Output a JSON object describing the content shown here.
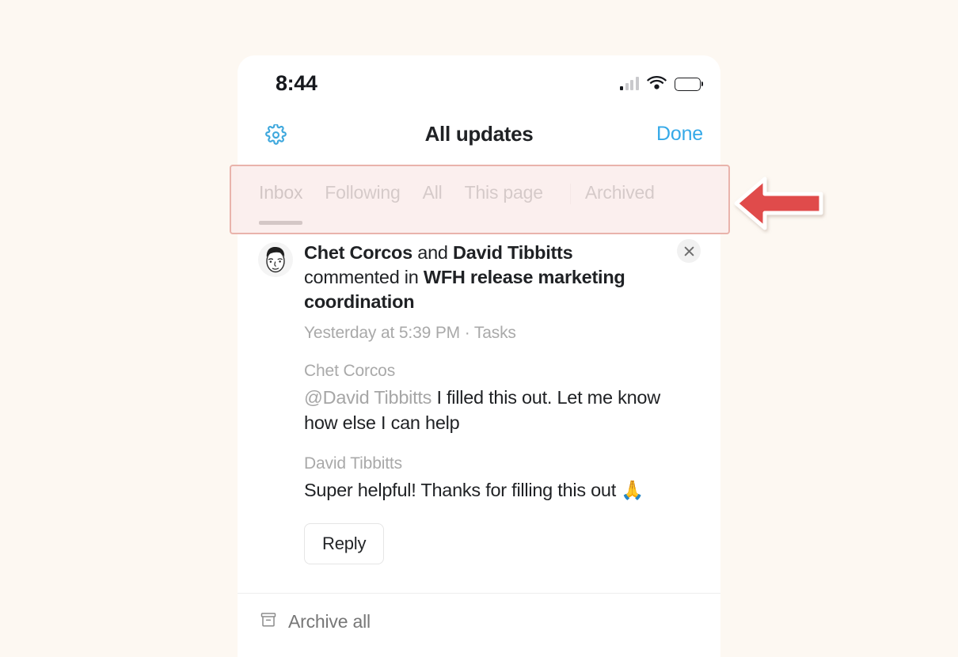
{
  "theme": {
    "page_background": "#fdf8f2",
    "card_background": "#ffffff",
    "accent_blue": "#35a9e8",
    "highlight_border": "#e9b3ab",
    "highlight_fill": "#faeceа",
    "arrow_red": "#e04b4b",
    "muted_text": "#a9a9a9"
  },
  "status_bar": {
    "time": "8:44",
    "signal_icon": "cellular-signal-icon",
    "wifi_icon": "wifi-icon",
    "battery_icon": "battery-full-icon"
  },
  "header": {
    "settings_icon": "gear-icon",
    "title": "All updates",
    "done_label": "Done"
  },
  "tabs": {
    "items": [
      {
        "label": "Inbox",
        "active": true
      },
      {
        "label": "Following",
        "active": false
      },
      {
        "label": "All",
        "active": false
      },
      {
        "label": "This page",
        "active": false
      },
      {
        "label": "Archived",
        "active": false,
        "separator_before": true
      }
    ]
  },
  "notification": {
    "avatar_icon": "user-avatar-face-icon",
    "close_icon": "close-icon",
    "headline": {
      "actor_one": "Chet Corcos",
      "conjunction": " and ",
      "actor_two": "David Tibbitts",
      "verb": " commented in ",
      "target": "WFH release marketing coordination"
    },
    "meta": "Yesterday at 5:39 PM · Tasks",
    "comments": [
      {
        "author": "Chet Corcos",
        "mention": "@David Tibbitts",
        "text": " I filled this out. Let me know how else I can help"
      },
      {
        "author": "David Tibbitts",
        "mention": "",
        "text": "Super helpful! Thanks for filling this out 🙏"
      }
    ],
    "reply_label": "Reply"
  },
  "footer": {
    "archive_icon": "archive-box-icon",
    "archive_all_label": "Archive all"
  },
  "annotation": {
    "arrow_icon": "arrow-left-icon",
    "points_at": "tabs"
  }
}
